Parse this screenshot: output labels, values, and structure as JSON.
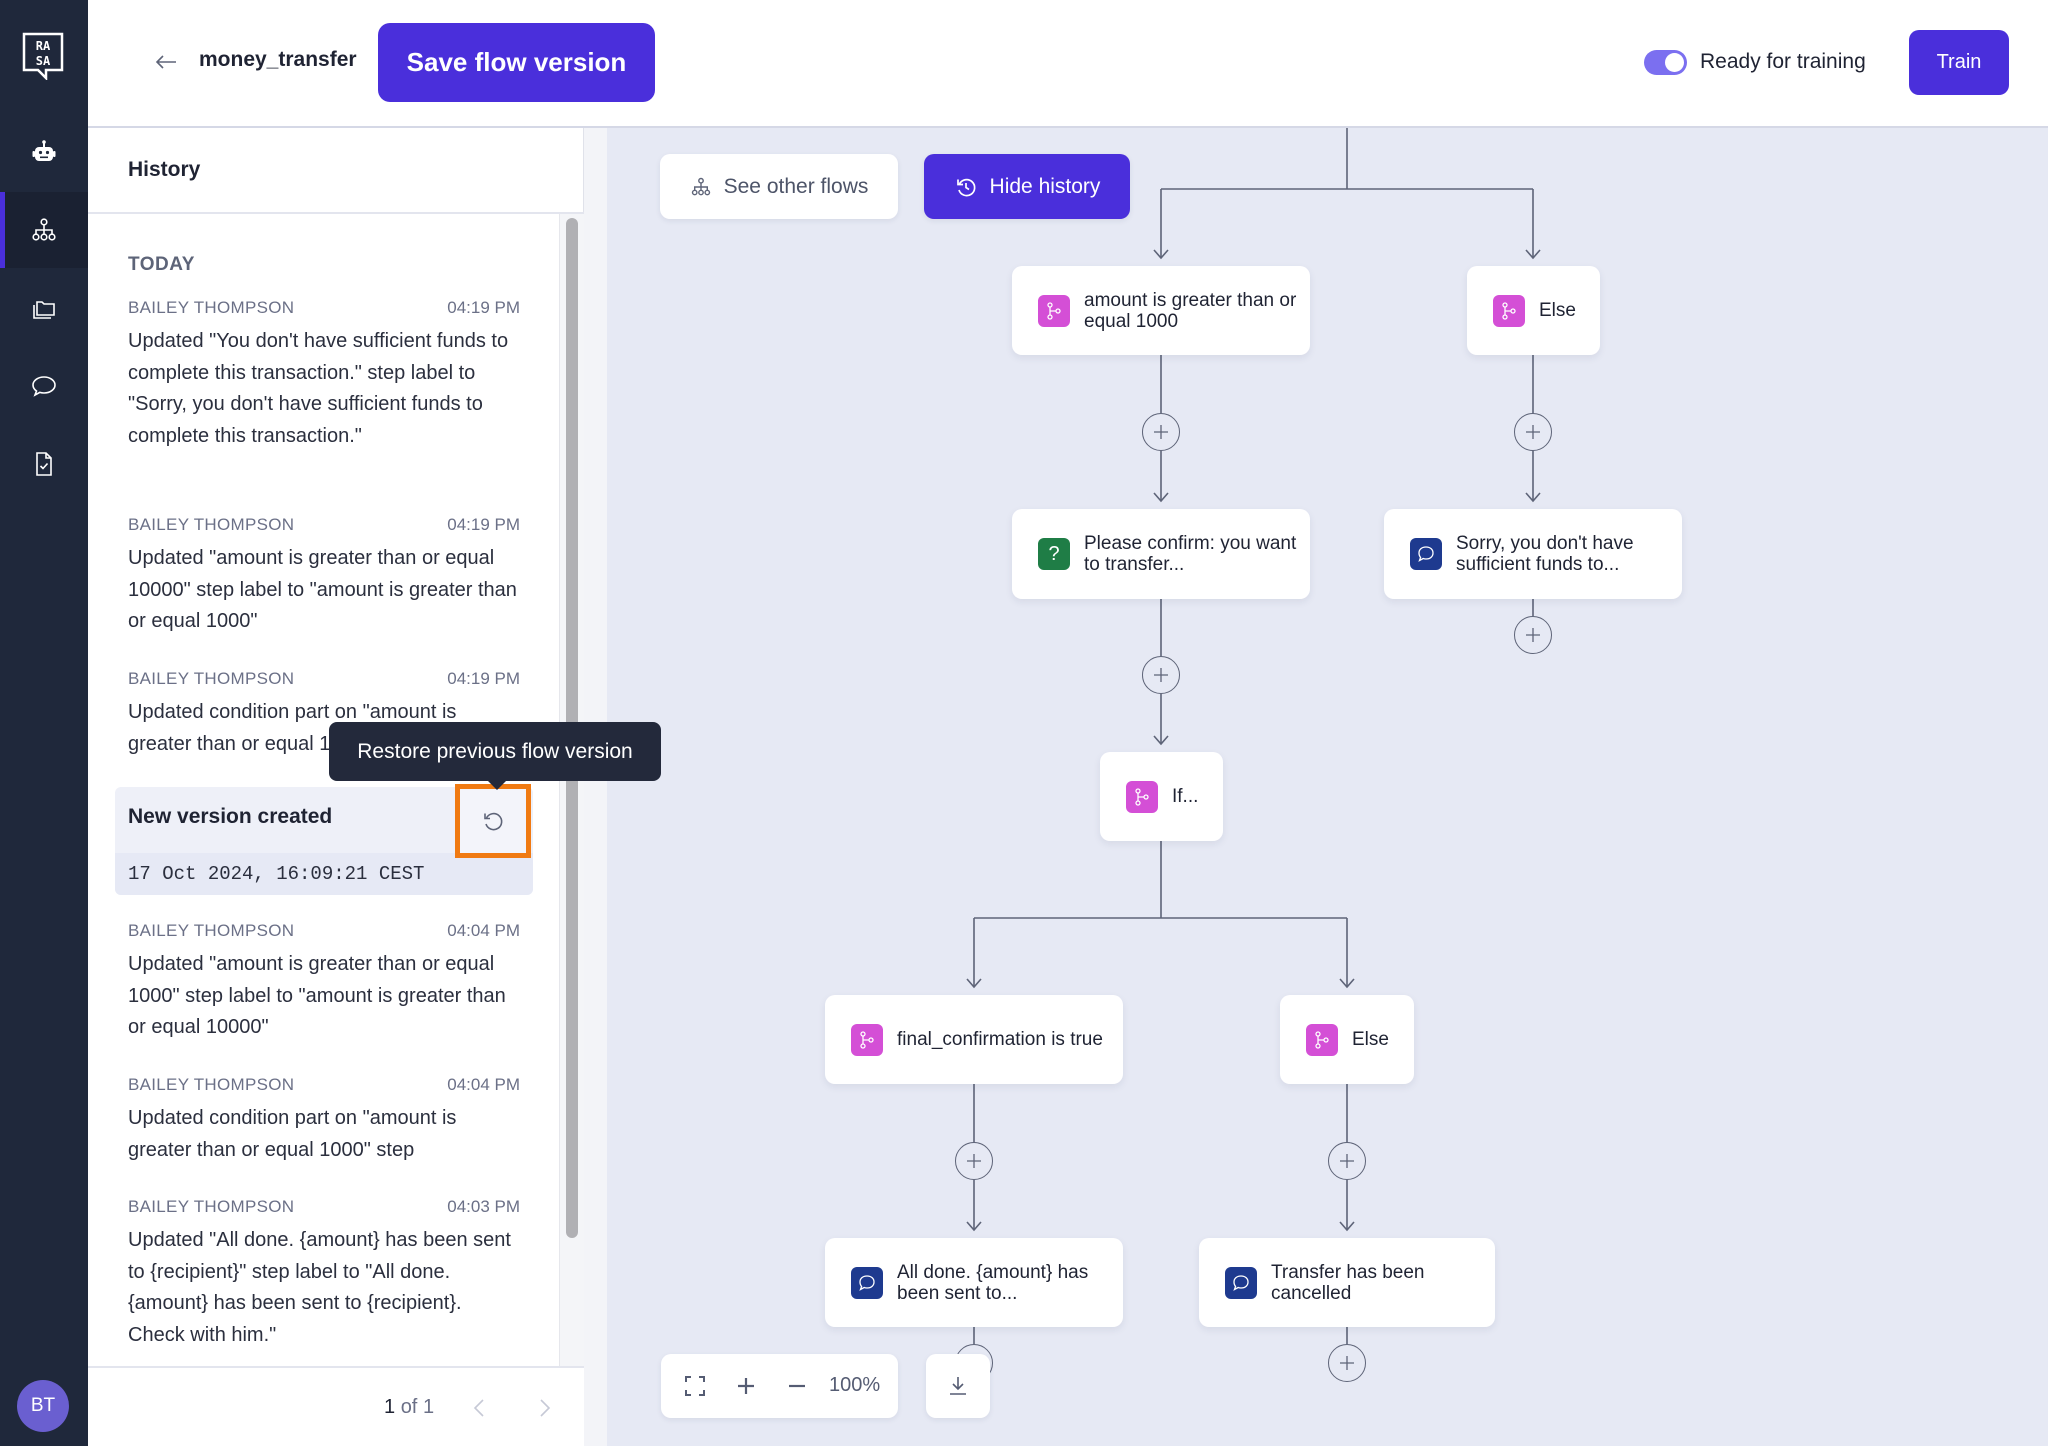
{
  "header": {
    "flow_name": "money_transfer",
    "save_label": "Save flow version",
    "ready_toggle_on": true,
    "ready_label": "Ready for training",
    "train_label": "Train"
  },
  "sidebar": {
    "items": [
      {
        "name": "assistant",
        "icon": "robot-icon"
      },
      {
        "name": "flows",
        "icon": "flow-tree-icon",
        "active": true
      },
      {
        "name": "content",
        "icon": "folder-stack-icon"
      },
      {
        "name": "conversations",
        "icon": "chat-bubble-icon"
      },
      {
        "name": "reviews",
        "icon": "document-check-icon"
      }
    ],
    "avatar_initials": "BT"
  },
  "history": {
    "title": "History",
    "group_label": "TODAY",
    "entries_before": [
      {
        "author": "BAILEY THOMPSON",
        "time": "04:19 PM",
        "text": "Updated \"You don't have sufficient funds to complete this transaction.\" step label to \"Sorry, you don't have sufficient funds to complete this transaction.\""
      },
      {
        "author": "BAILEY THOMPSON",
        "time": "04:19 PM",
        "text": "Updated \"amount is greater than or equal 10000\" step label to \"amount is greater than or equal 1000\""
      },
      {
        "author": "BAILEY THOMPSON",
        "time": "04:19 PM",
        "text": "Updated condition part on \"amount is greater than or equal 1000\" step"
      }
    ],
    "version": {
      "title": "New version created",
      "date": "17 Oct 2024, 16:09:21 CEST",
      "restore_tooltip": "Restore previous flow version"
    },
    "entries_after": [
      {
        "author": "BAILEY THOMPSON",
        "time": "04:04 PM",
        "text": "Updated \"amount is greater than or equal 1000\" step label to \"amount is greater than or equal 10000\""
      },
      {
        "author": "BAILEY THOMPSON",
        "time": "04:04 PM",
        "text": "Updated condition part on \"amount is greater than or equal 1000\" step"
      },
      {
        "author": "BAILEY THOMPSON",
        "time": "04:03 PM",
        "text": "Updated \"All done. {amount} has been sent to {recipient}\" step label to \"All done. {amount} has been sent to {recipient}. Check with him.\""
      }
    ],
    "pagination": {
      "current": "1",
      "of_label": "of",
      "total": "1"
    }
  },
  "canvas": {
    "see_other_flows_label": "See other flows",
    "hide_history_label": "Hide history",
    "zoom_level": "100%",
    "nodes": [
      {
        "id": "cond-amount",
        "type": "branch",
        "label": "amount is greater than or equal 1000"
      },
      {
        "id": "else-1",
        "type": "branch",
        "label": "Else"
      },
      {
        "id": "confirm",
        "type": "question",
        "label": "Please confirm: you want to transfer..."
      },
      {
        "id": "insufficient",
        "type": "message",
        "label": "Sorry, you don't have sufficient funds to..."
      },
      {
        "id": "if",
        "type": "branch",
        "label": "If..."
      },
      {
        "id": "cond-final",
        "type": "branch",
        "label": "final_confirmation is true"
      },
      {
        "id": "else-2",
        "type": "branch",
        "label": "Else"
      },
      {
        "id": "done",
        "type": "message",
        "label": "All done. {amount} has been sent to..."
      },
      {
        "id": "cancelled",
        "type": "message",
        "label": "Transfer has been cancelled"
      }
    ]
  },
  "colors": {
    "brand": "#4a2fdb",
    "sidebar": "#1f283b",
    "branch_icon": "#d44fd6",
    "question_icon": "#1f7d46",
    "message_icon": "#1e3a8f",
    "highlight": "#f07a12",
    "canvas_bg": "#e6e9f4"
  }
}
